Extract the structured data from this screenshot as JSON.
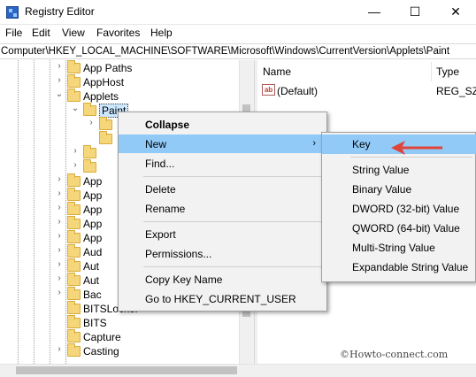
{
  "window": {
    "title": "Registry Editor",
    "controls": {
      "minimize": "—",
      "maximize": "☐",
      "close": "✕"
    }
  },
  "menubar": [
    "File",
    "Edit",
    "View",
    "Favorites",
    "Help"
  ],
  "address": "Computer\\HKEY_LOCAL_MACHINE\\SOFTWARE\\Microsoft\\Windows\\CurrentVersion\\Applets\\Paint",
  "tree": [
    {
      "label": "App Paths",
      "chev": "›"
    },
    {
      "label": "AppHost",
      "chev": "›"
    },
    {
      "label": "Applets",
      "chev": "⌄"
    },
    {
      "label": "Paint",
      "chev": "⌄",
      "selected": true
    },
    {
      "label": "",
      "chev": "›"
    },
    {
      "label": "",
      "chev": ""
    },
    {
      "label": "",
      "chev": "›"
    },
    {
      "label": "",
      "chev": "›"
    },
    {
      "label": "App",
      "chev": "›"
    },
    {
      "label": "App",
      "chev": "›"
    },
    {
      "label": "App",
      "chev": "›"
    },
    {
      "label": "App",
      "chev": "›"
    },
    {
      "label": "App",
      "chev": "›"
    },
    {
      "label": "Aud",
      "chev": "›"
    },
    {
      "label": "Aut",
      "chev": "›"
    },
    {
      "label": "Aut",
      "chev": "›"
    },
    {
      "label": "Bac",
      "chev": "›"
    },
    {
      "label": "BITSLocker",
      "chev": ""
    },
    {
      "label": "BITS",
      "chev": ""
    },
    {
      "label": "Capture",
      "chev": ""
    },
    {
      "label": "Casting",
      "chev": "›"
    }
  ],
  "right_pane": {
    "columns": [
      "Name",
      "Type"
    ],
    "values": [
      {
        "icon": "ab",
        "name": "(Default)",
        "type": "REG_SZ"
      }
    ]
  },
  "context_menu": {
    "items": [
      {
        "label": "Collapse",
        "bold": true
      },
      {
        "label": "New",
        "highlighted": true,
        "submenu_arrow": "›"
      },
      {
        "label": "Find..."
      },
      {
        "sep": true
      },
      {
        "label": "Delete"
      },
      {
        "label": "Rename"
      },
      {
        "sep": true
      },
      {
        "label": "Export"
      },
      {
        "label": "Permissions..."
      },
      {
        "sep": true
      },
      {
        "label": "Copy Key Name"
      },
      {
        "label": "Go to HKEY_CURRENT_USER"
      }
    ]
  },
  "submenu": {
    "items": [
      {
        "label": "Key",
        "highlighted": true
      },
      {
        "sep": true
      },
      {
        "label": "String Value"
      },
      {
        "label": "Binary Value"
      },
      {
        "label": "DWORD (32-bit) Value"
      },
      {
        "label": "QWORD (64-bit) Value"
      },
      {
        "label": "Multi-String Value"
      },
      {
        "label": "Expandable String Value"
      }
    ]
  },
  "watermark": "©Howto-connect.com",
  "colors": {
    "highlight": "#91c9f7",
    "arrow": "#e0453a",
    "folder": "#f5d67a"
  }
}
